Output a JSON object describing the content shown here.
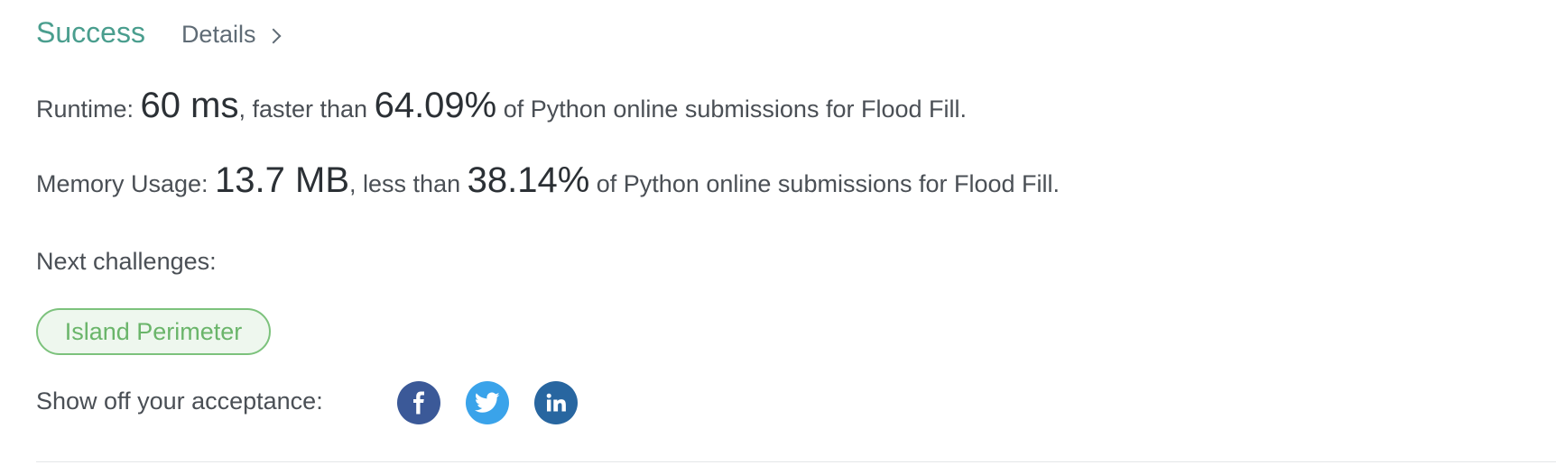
{
  "header": {
    "status": "Success",
    "details_label": "Details"
  },
  "runtime": {
    "label": "Runtime: ",
    "value": "60 ms",
    "mid": ", faster than ",
    "percent": "64.09%",
    "suffix": " of Python online submissions for Flood Fill."
  },
  "memory": {
    "label": "Memory Usage: ",
    "value": "13.7 MB",
    "mid": ", less than ",
    "percent": "38.14%",
    "suffix": " of Python online submissions for Flood Fill."
  },
  "next": {
    "label": "Next challenges:",
    "challenges": [
      "Island Perimeter"
    ]
  },
  "share": {
    "label": "Show off your acceptance:",
    "icons": [
      "facebook-icon",
      "twitter-icon",
      "linkedin-icon"
    ]
  },
  "colors": {
    "success": "#4a9e8e",
    "tag_border": "#7cc27c",
    "facebook": "#3b5998",
    "twitter": "#3aa3ea",
    "linkedin": "#2866a0"
  }
}
